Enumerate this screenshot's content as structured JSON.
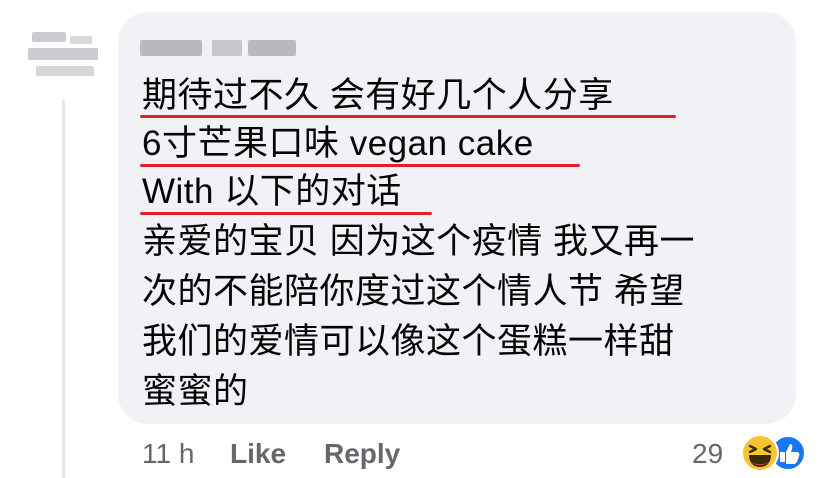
{
  "comment": {
    "lines": [
      "期待过不久 会有好几个人分享",
      "6寸芒果口味 vegan cake",
      "With 以下的对话",
      "亲爱的宝贝 因为这个疫情 我又再一",
      "次的不能陪你度过这个情人节 希望",
      "我们的爱情可以像这个蛋糕一样甜",
      "蜜蜜的"
    ]
  },
  "actions": {
    "time": "11 h",
    "like_label": "Like",
    "reply_label": "Reply"
  },
  "reactions": {
    "count": "29",
    "icons": [
      "laugh-emoji-icon",
      "like-thumb-icon"
    ],
    "colors": {
      "laugh": "#f7c433",
      "like": "#1877f2"
    }
  },
  "colors": {
    "bubble": "#f0f2f5",
    "underline": "#e0202a",
    "text": "#050505",
    "muted": "#65676b"
  }
}
